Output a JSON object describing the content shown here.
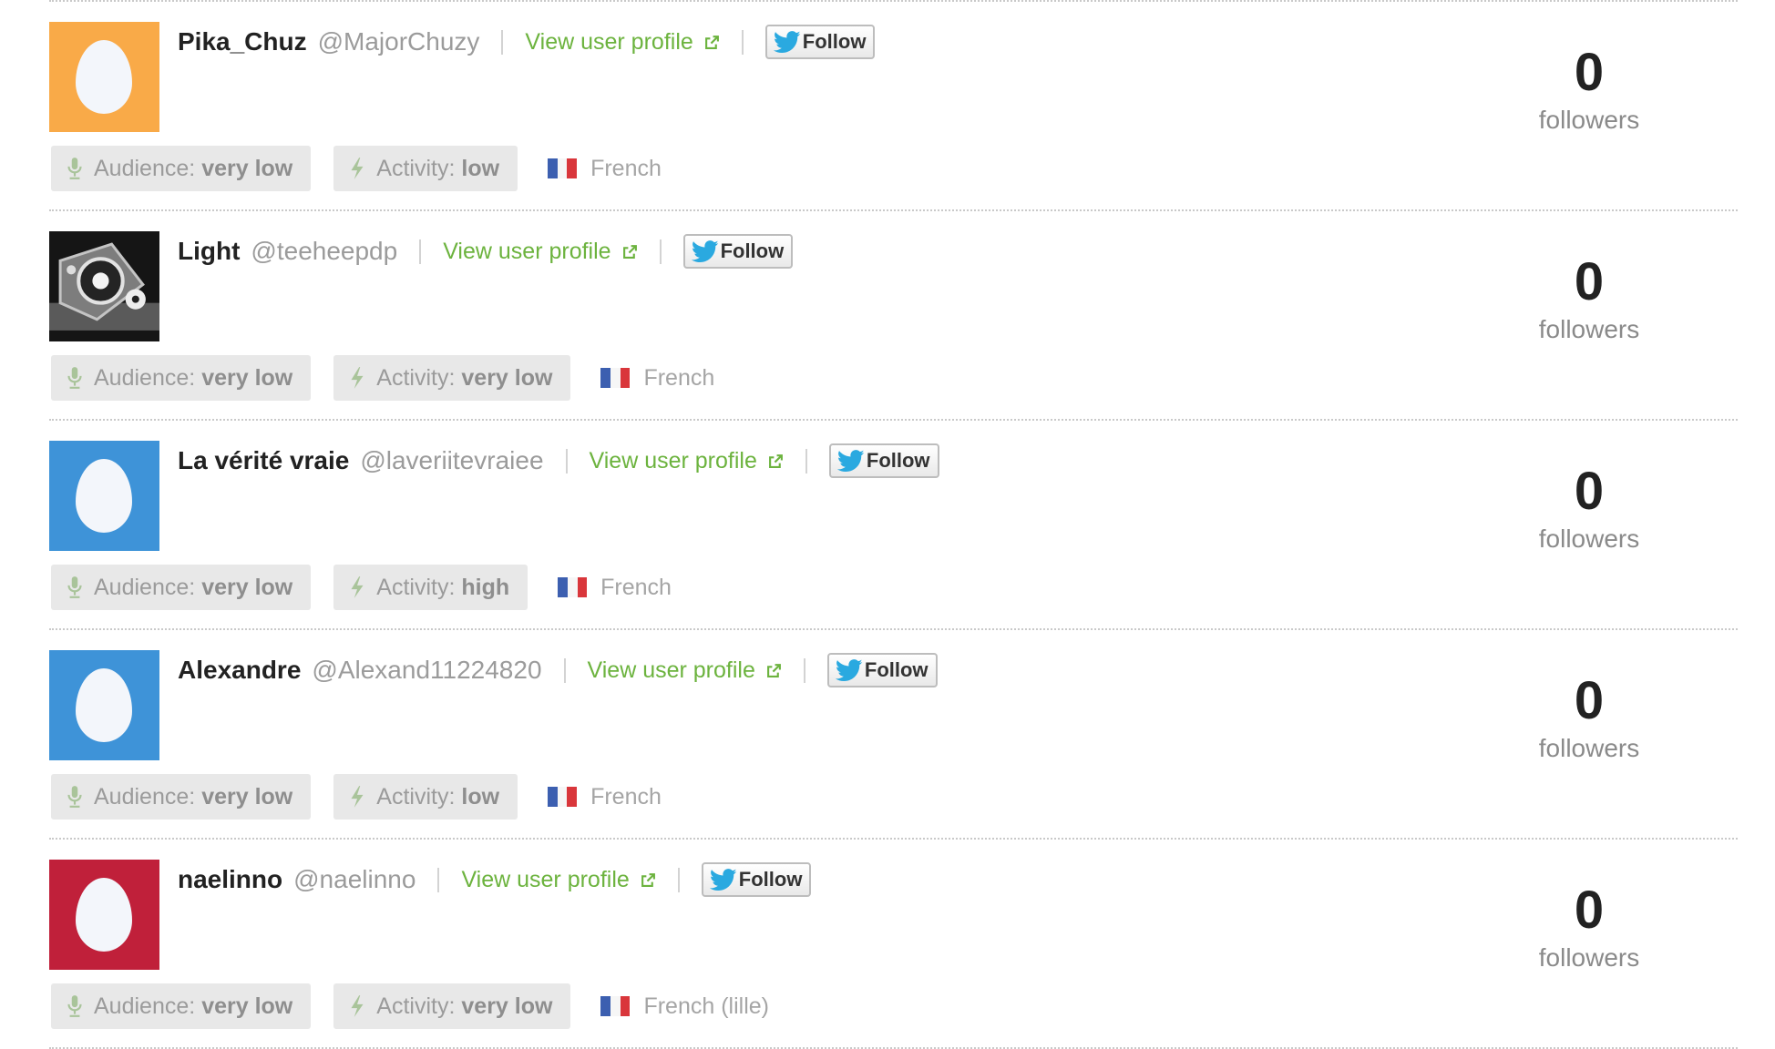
{
  "ui": {
    "view_profile_label": "View user profile",
    "follow_label": "Follow",
    "audience_label": "Audience:",
    "activity_label": "Activity:",
    "followers_label": "followers"
  },
  "colors": {
    "link_green": "#6cb33e",
    "twitter_blue": "#2aa9e0"
  },
  "users": [
    {
      "name": "Pika_Chuz",
      "handle": "@MajorChuzy",
      "avatar": "egg",
      "avatar_color": "#f9aa48",
      "audience": "very low",
      "activity": "low",
      "language": "French",
      "followers": "0"
    },
    {
      "name": "Light",
      "handle": "@teeheepdp",
      "avatar": "photo",
      "avatar_color": "#1b1b1b",
      "audience": "very low",
      "activity": "very low",
      "language": "French",
      "followers": "0"
    },
    {
      "name": "La vérité vraie",
      "handle": "@laveriitevraiee",
      "avatar": "egg",
      "avatar_color": "#3e93d8",
      "audience": "very low",
      "activity": "high",
      "language": "French",
      "followers": "0"
    },
    {
      "name": "Alexandre",
      "handle": "@Alexand11224820",
      "avatar": "egg",
      "avatar_color": "#3e93d8",
      "audience": "very low",
      "activity": "low",
      "language": "French",
      "followers": "0"
    },
    {
      "name": "naelinno",
      "handle": "@naelinno",
      "avatar": "egg",
      "avatar_color": "#c0203a",
      "audience": "very low",
      "activity": "very low",
      "language": "French (lille)",
      "followers": "0"
    }
  ]
}
